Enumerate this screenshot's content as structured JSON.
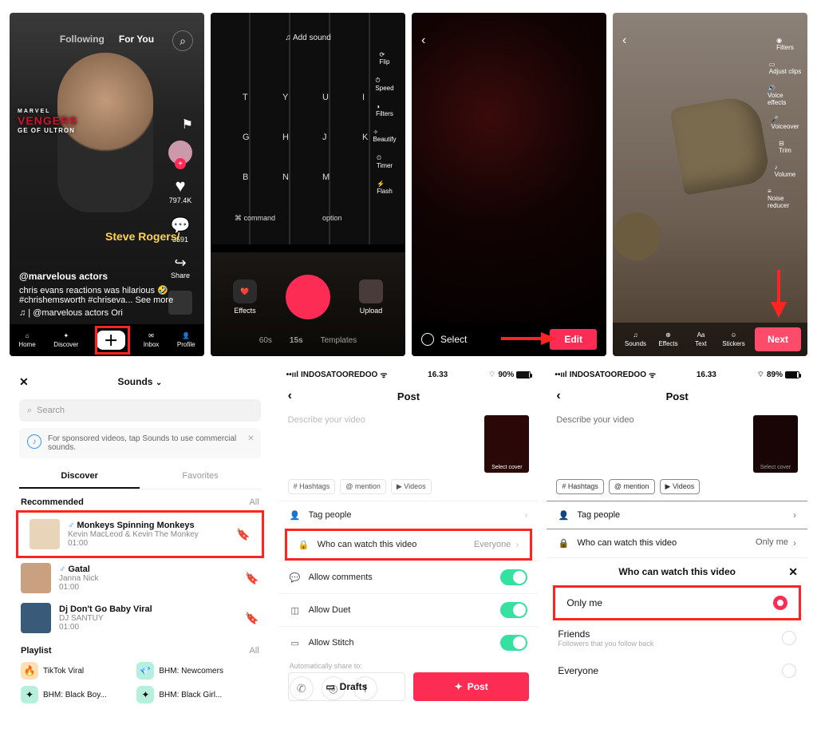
{
  "s1": {
    "following": "Following",
    "foryou": "For You",
    "likes": "797.4K",
    "comments": "3591",
    "share": "Share",
    "user": "@marvelous actors",
    "caption_line1": "chris evans reactions was hilarious 🤣",
    "caption_line2": "#chrishemsworth #chriseva...  See more",
    "sound": "♫  |  @marvelous actors Ori",
    "overlay": "Steve Rogers/",
    "marvel_top": "MARVEL",
    "marvel_mid": "VENGERS",
    "marvel_bot": "GE OF ULTRON",
    "nav": {
      "home": "Home",
      "discover": "Discover",
      "inbox": "Inbox",
      "profile": "Profile"
    }
  },
  "s2": {
    "add_sound": "♫  Add sound",
    "tools": [
      "Flip",
      "Speed",
      "Filters",
      "Beautify",
      "Timer",
      "Flash"
    ],
    "effects": "Effects",
    "upload": "Upload",
    "d60": "60s",
    "d15": "15s",
    "tmpl": "Templates",
    "keys": [
      "T",
      "Y",
      "U",
      "I",
      "G",
      "H",
      "J",
      "K",
      "B",
      "N",
      "M",
      "⌘ command",
      "option"
    ]
  },
  "s3": {
    "select": "Select",
    "edit": "Edit"
  },
  "s4": {
    "tools": [
      "Filters",
      "Adjust clips",
      "Voice effects",
      "Voiceover",
      "Trim",
      "Volume",
      "Noise reducer"
    ],
    "footer": [
      "Sounds",
      "Effects",
      "Text",
      "Stickers"
    ],
    "next": "Next"
  },
  "s5": {
    "title": "Sounds",
    "search_ph": "Search",
    "promo": "For sponsored videos, tap Sounds to use commercial sounds.",
    "tab_discover": "Discover",
    "tab_fav": "Favorites",
    "recommended": "Recommended",
    "all": "All",
    "songs": [
      {
        "t": "Monkeys Spinning Monkeys",
        "a": "Kevin MacLeod & Kevin The Monkey",
        "d": "01:00",
        "note": "♂"
      },
      {
        "t": "Gatal",
        "a": "Janna Nick",
        "d": "01:00",
        "note": "♂"
      },
      {
        "t": "Dj Don't Go Baby Viral",
        "a": "DJ SANTUY",
        "d": "01:00",
        "note": ""
      }
    ],
    "playlist_h": "Playlist",
    "playlists": [
      "TikTok Viral",
      "BHM: Newcomers",
      "BHM: Black Boy...",
      "BHM: Black Girl..."
    ]
  },
  "s6": {
    "carrier": "INDOSATOOREDOO",
    "wifi": "ᯤ",
    "time": "16.33",
    "batt": "90%",
    "title": "Post",
    "describe": "Describe your video",
    "cover": "Select cover",
    "chips": [
      "# Hashtags",
      "@ mention",
      "▶ Videos"
    ],
    "tag": "Tag people",
    "who": "Who can watch this video",
    "who_val": "Everyone",
    "comments": "Allow comments",
    "duet": "Allow Duet",
    "stitch": "Allow Stitch",
    "auto": "Automatically share to:",
    "drafts": "Drafts",
    "post": "Post"
  },
  "s7": {
    "carrier": "INDOSATOOREDOO",
    "time": "16.33",
    "batt": "89%",
    "title": "Post",
    "describe": "Describe your video",
    "cover": "Select cover",
    "chips": [
      "# Hashtags",
      "@ mention",
      "▶ Videos"
    ],
    "tag": "Tag people",
    "who": "Who can watch this video",
    "who_val": "Only me",
    "sheet_title": "Who can watch this video",
    "only": "Only me",
    "friends": "Friends",
    "friends_sub": "Followers that you follow back",
    "everyone": "Everyone"
  }
}
